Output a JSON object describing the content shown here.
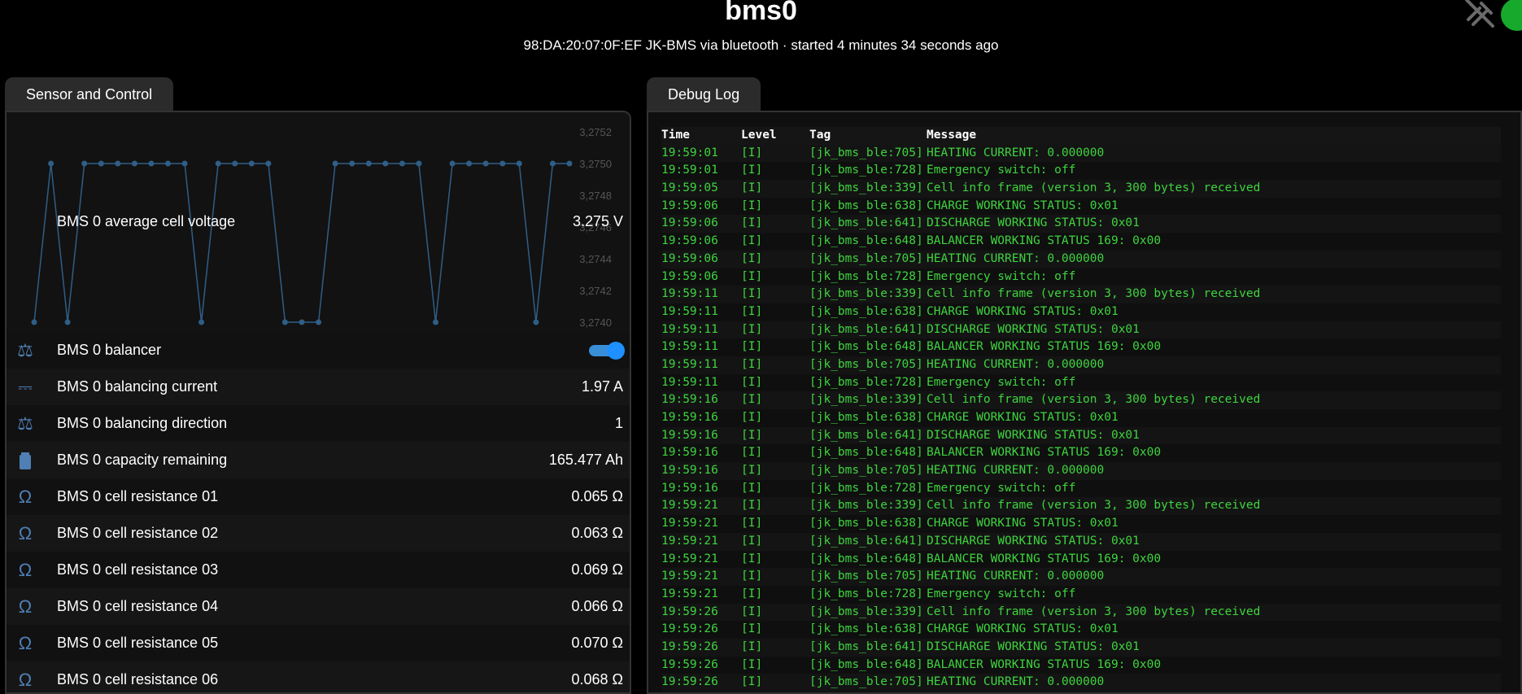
{
  "header": {
    "title": "bms0",
    "subtitle": "98:DA:20:07:0F:EF JK-BMS via bluetooth · started 4 minutes 34 seconds ago",
    "status_color": "#17a92b"
  },
  "tabs": {
    "sensor": "Sensor and Control",
    "debug": "Debug Log"
  },
  "chart_data": {
    "type": "line",
    "title": "",
    "y_ticks": [
      "3,2752",
      "3,2750",
      "3,2748",
      "3,2746",
      "3,2744",
      "3,2742",
      "3,2740"
    ],
    "ylim": [
      3.274,
      3.2752
    ],
    "series": [
      {
        "values": [
          3.274,
          3.275,
          3.274,
          3.275,
          3.275,
          3.275,
          3.275,
          3.275,
          3.275,
          3.275,
          3.274,
          3.275,
          3.275,
          3.275,
          3.275,
          3.274,
          3.274,
          3.274,
          3.275,
          3.275,
          3.275,
          3.275,
          3.275,
          3.275,
          3.274,
          3.275,
          3.275,
          3.275,
          3.275,
          3.275,
          3.274,
          3.275,
          3.275
        ]
      }
    ],
    "color": "#2f5e86"
  },
  "chart_label": "BMS 0 average cell voltage",
  "chart_value": "3.275 V",
  "rows": [
    {
      "icon": "balance-scale-icon",
      "label": "BMS 0 balancer",
      "value": "",
      "toggle": true
    },
    {
      "icon": "current-dc-icon",
      "label": "BMS 0 balancing current",
      "value": "1.97 A"
    },
    {
      "icon": "balance-scale-icon",
      "label": "BMS 0 balancing direction",
      "value": "1"
    },
    {
      "icon": "battery-icon",
      "label": "BMS 0 capacity remaining",
      "value": "165.477 Ah"
    },
    {
      "icon": "omega-icon",
      "label": "BMS 0 cell resistance 01",
      "value": "0.065 Ω"
    },
    {
      "icon": "omega-icon",
      "label": "BMS 0 cell resistance 02",
      "value": "0.063 Ω"
    },
    {
      "icon": "omega-icon",
      "label": "BMS 0 cell resistance 03",
      "value": "0.069 Ω"
    },
    {
      "icon": "omega-icon",
      "label": "BMS 0 cell resistance 04",
      "value": "0.066 Ω"
    },
    {
      "icon": "omega-icon",
      "label": "BMS 0 cell resistance 05",
      "value": "0.070 Ω"
    },
    {
      "icon": "omega-icon",
      "label": "BMS 0 cell resistance 06",
      "value": "0.068 Ω"
    }
  ],
  "icons": {
    "omega": "Ω",
    "current": "⎓",
    "balance": "⚖"
  },
  "log": {
    "headers": {
      "time": "Time",
      "level": "Level",
      "tag": "Tag",
      "message": "Message"
    },
    "lines": [
      [
        "19:59:01",
        "[I]",
        "[jk_bms_ble:705]",
        "HEATING CURRENT: 0.000000"
      ],
      [
        "19:59:01",
        "[I]",
        "[jk_bms_ble:728]",
        "Emergency switch: off"
      ],
      [
        "19:59:05",
        "[I]",
        "[jk_bms_ble:339]",
        "Cell info frame (version 3, 300 bytes) received"
      ],
      [
        "19:59:06",
        "[I]",
        "[jk_bms_ble:638]",
        "CHARGE WORKING STATUS: 0x01"
      ],
      [
        "19:59:06",
        "[I]",
        "[jk_bms_ble:641]",
        "DISCHARGE WORKING STATUS: 0x01"
      ],
      [
        "19:59:06",
        "[I]",
        "[jk_bms_ble:648]",
        "BALANCER WORKING STATUS 169: 0x00"
      ],
      [
        "19:59:06",
        "[I]",
        "[jk_bms_ble:705]",
        "HEATING CURRENT: 0.000000"
      ],
      [
        "19:59:06",
        "[I]",
        "[jk_bms_ble:728]",
        "Emergency switch: off"
      ],
      [
        "19:59:11",
        "[I]",
        "[jk_bms_ble:339]",
        "Cell info frame (version 3, 300 bytes) received"
      ],
      [
        "19:59:11",
        "[I]",
        "[jk_bms_ble:638]",
        "CHARGE WORKING STATUS: 0x01"
      ],
      [
        "19:59:11",
        "[I]",
        "[jk_bms_ble:641]",
        "DISCHARGE WORKING STATUS: 0x01"
      ],
      [
        "19:59:11",
        "[I]",
        "[jk_bms_ble:648]",
        "BALANCER WORKING STATUS 169: 0x00"
      ],
      [
        "19:59:11",
        "[I]",
        "[jk_bms_ble:705]",
        "HEATING CURRENT: 0.000000"
      ],
      [
        "19:59:11",
        "[I]",
        "[jk_bms_ble:728]",
        "Emergency switch: off"
      ],
      [
        "19:59:16",
        "[I]",
        "[jk_bms_ble:339]",
        "Cell info frame (version 3, 300 bytes) received"
      ],
      [
        "19:59:16",
        "[I]",
        "[jk_bms_ble:638]",
        "CHARGE WORKING STATUS: 0x01"
      ],
      [
        "19:59:16",
        "[I]",
        "[jk_bms_ble:641]",
        "DISCHARGE WORKING STATUS: 0x01"
      ],
      [
        "19:59:16",
        "[I]",
        "[jk_bms_ble:648]",
        "BALANCER WORKING STATUS 169: 0x00"
      ],
      [
        "19:59:16",
        "[I]",
        "[jk_bms_ble:705]",
        "HEATING CURRENT: 0.000000"
      ],
      [
        "19:59:16",
        "[I]",
        "[jk_bms_ble:728]",
        "Emergency switch: off"
      ],
      [
        "19:59:21",
        "[I]",
        "[jk_bms_ble:339]",
        "Cell info frame (version 3, 300 bytes) received"
      ],
      [
        "19:59:21",
        "[I]",
        "[jk_bms_ble:638]",
        "CHARGE WORKING STATUS: 0x01"
      ],
      [
        "19:59:21",
        "[I]",
        "[jk_bms_ble:641]",
        "DISCHARGE WORKING STATUS: 0x01"
      ],
      [
        "19:59:21",
        "[I]",
        "[jk_bms_ble:648]",
        "BALANCER WORKING STATUS 169: 0x00"
      ],
      [
        "19:59:21",
        "[I]",
        "[jk_bms_ble:705]",
        "HEATING CURRENT: 0.000000"
      ],
      [
        "19:59:21",
        "[I]",
        "[jk_bms_ble:728]",
        "Emergency switch: off"
      ],
      [
        "19:59:26",
        "[I]",
        "[jk_bms_ble:339]",
        "Cell info frame (version 3, 300 bytes) received"
      ],
      [
        "19:59:26",
        "[I]",
        "[jk_bms_ble:638]",
        "CHARGE WORKING STATUS: 0x01"
      ],
      [
        "19:59:26",
        "[I]",
        "[jk_bms_ble:641]",
        "DISCHARGE WORKING STATUS: 0x01"
      ],
      [
        "19:59:26",
        "[I]",
        "[jk_bms_ble:648]",
        "BALANCER WORKING STATUS 169: 0x00"
      ],
      [
        "19:59:26",
        "[I]",
        "[jk_bms_ble:705]",
        "HEATING CURRENT: 0.000000"
      ]
    ]
  }
}
